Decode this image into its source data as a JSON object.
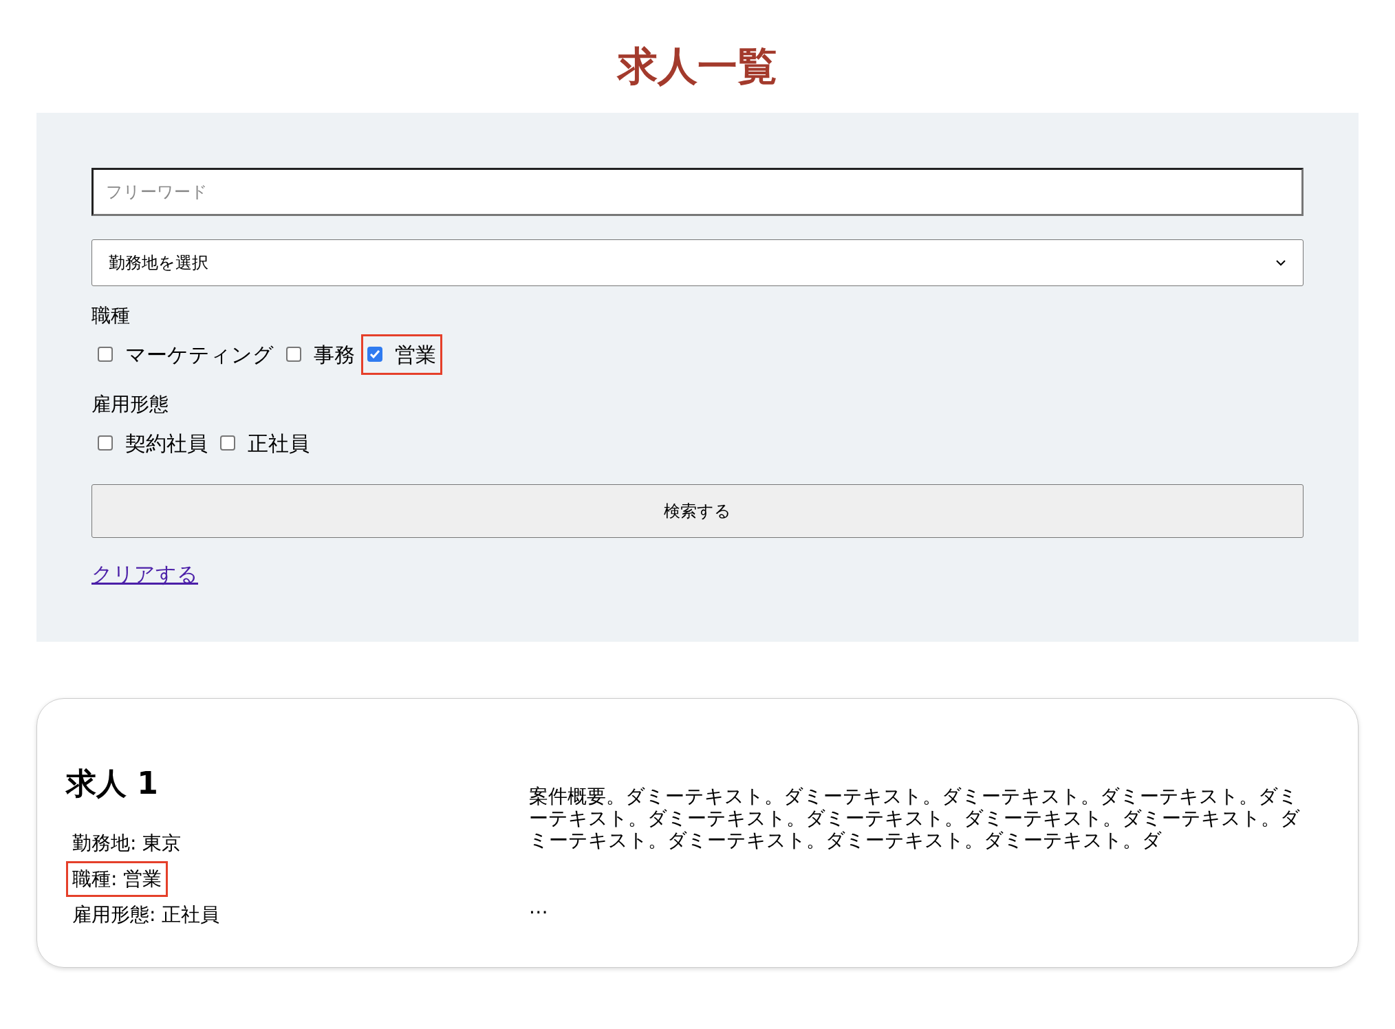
{
  "page_title": "求人一覧",
  "search": {
    "freeword": {
      "placeholder": "フリーワード"
    },
    "location": {
      "value": "勤務地を選択"
    },
    "groups": [
      {
        "label": "職種",
        "options": [
          {
            "label": "マーケティング",
            "checked": false,
            "highlighted": false
          },
          {
            "label": "事務",
            "checked": false,
            "highlighted": false
          },
          {
            "label": "営業",
            "checked": true,
            "highlighted": true
          }
        ]
      },
      {
        "label": "雇用形態",
        "options": [
          {
            "label": "契約社員",
            "checked": false,
            "highlighted": false
          },
          {
            "label": "正社員",
            "checked": false,
            "highlighted": false
          }
        ]
      }
    ],
    "submit": "検索する",
    "clear": "クリアする"
  },
  "jobs": [
    {
      "title": "求人 1",
      "fields": [
        {
          "text": "勤務地: 東京",
          "highlighted": false
        },
        {
          "text": "職種: 営業",
          "highlighted": true
        },
        {
          "text": "雇用形態: 正社員",
          "highlighted": false
        }
      ],
      "summary": "案件概要。ダミーテキスト。ダミーテキスト。ダミーテキスト。ダミーテキスト。ダミーテキスト。ダミーテキスト。ダミーテキスト。ダミーテキスト。ダミーテキスト。ダミーテキスト。ダミーテキスト。ダミーテキスト。ダミーテキスト。ダ",
      "more": "…"
    }
  ]
}
